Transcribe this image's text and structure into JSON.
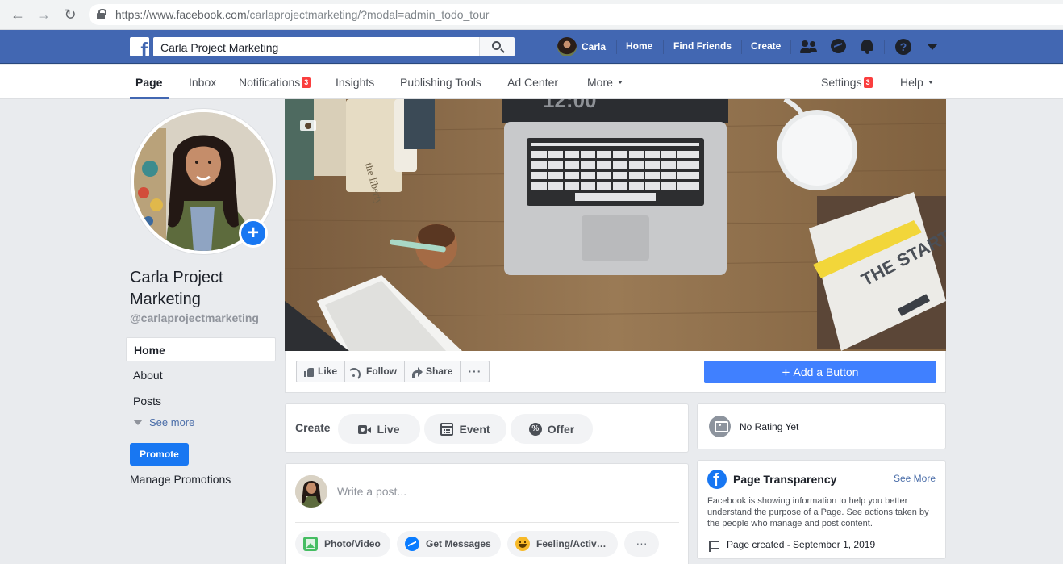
{
  "browser": {
    "url_host": "https://www.facebook.com",
    "url_path": "/carlaprojectmarketing/?modal=admin_todo_tour"
  },
  "topbar": {
    "search_value": "Carla Project Marketing",
    "user_name": "Carla",
    "links": [
      "Home",
      "Find Friends",
      "Create"
    ],
    "brand_color": "#4267b2"
  },
  "page_tabs": {
    "page": "Page",
    "inbox": "Inbox",
    "notifications": "Notifications",
    "notifications_count": "3",
    "insights": "Insights",
    "publishing_tools": "Publishing Tools",
    "ad_center": "Ad Center",
    "more": "More",
    "settings": "Settings",
    "settings_count": "3",
    "help": "Help"
  },
  "sidebar": {
    "page_name": "Carla Project Marketing",
    "handle": "@carlaprojectmarketing",
    "items": [
      "Home",
      "About",
      "Posts"
    ],
    "see_more": "See more",
    "promote": "Promote",
    "manage_promotions": "Manage Promotions"
  },
  "actions": {
    "like": "Like",
    "follow": "Follow",
    "share": "Share",
    "more": "···",
    "add_button": "Add a Button"
  },
  "create": {
    "label": "Create",
    "live": "Live",
    "event": "Event",
    "offer": "Offer"
  },
  "rating": {
    "text": "No Rating Yet"
  },
  "composer": {
    "placeholder": "Write a post...",
    "photo_video": "Photo/Video",
    "get_messages": "Get Messages",
    "feeling": "Feeling/Activ…",
    "more": "···"
  },
  "transparency": {
    "title": "Page Transparency",
    "see_more": "See More",
    "body": "Facebook is showing information to help you better understand the purpose of a Page. See actions taken by the people who manage and post content.",
    "created": "Page created - September 1, 2019"
  },
  "cover": {
    "book_title": "THE STARTUP PLAYBOOK",
    "clock": "12:00"
  }
}
